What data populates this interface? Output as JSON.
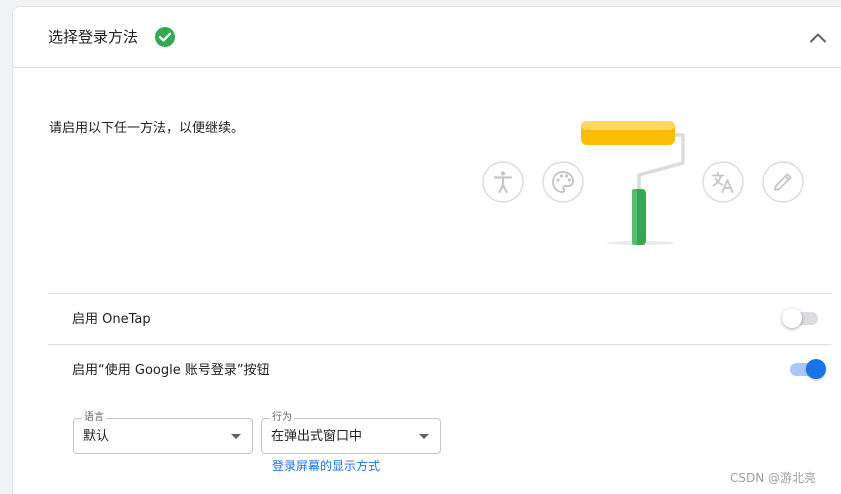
{
  "section": {
    "title": "选择登录方法",
    "intro": "请启用以下任一方法，以便继续。"
  },
  "icons": {
    "complete": "check-circle-icon",
    "collapse": "chevron-up-icon",
    "illustration": [
      "accessibility-icon",
      "palette-icon",
      "paint-roller-icon",
      "translate-icon",
      "pencil-icon"
    ]
  },
  "options": {
    "onetap": {
      "label": "启用 OneTap",
      "enabled": false
    },
    "google_button": {
      "label": "启用“使用 Google 账号登录”按钮",
      "enabled": true
    }
  },
  "selects": {
    "language": {
      "label": "语言",
      "value": "默认"
    },
    "behavior": {
      "label": "行为",
      "value": "在弹出式窗口中"
    }
  },
  "link": {
    "text": "登录屏幕的显示方式"
  },
  "watermark": "CSDN @游北亮",
  "colors": {
    "accent": "#1a73e8",
    "success": "#34a853",
    "roller_yellow": "#fbbc04",
    "handle_green": "#34a853"
  }
}
